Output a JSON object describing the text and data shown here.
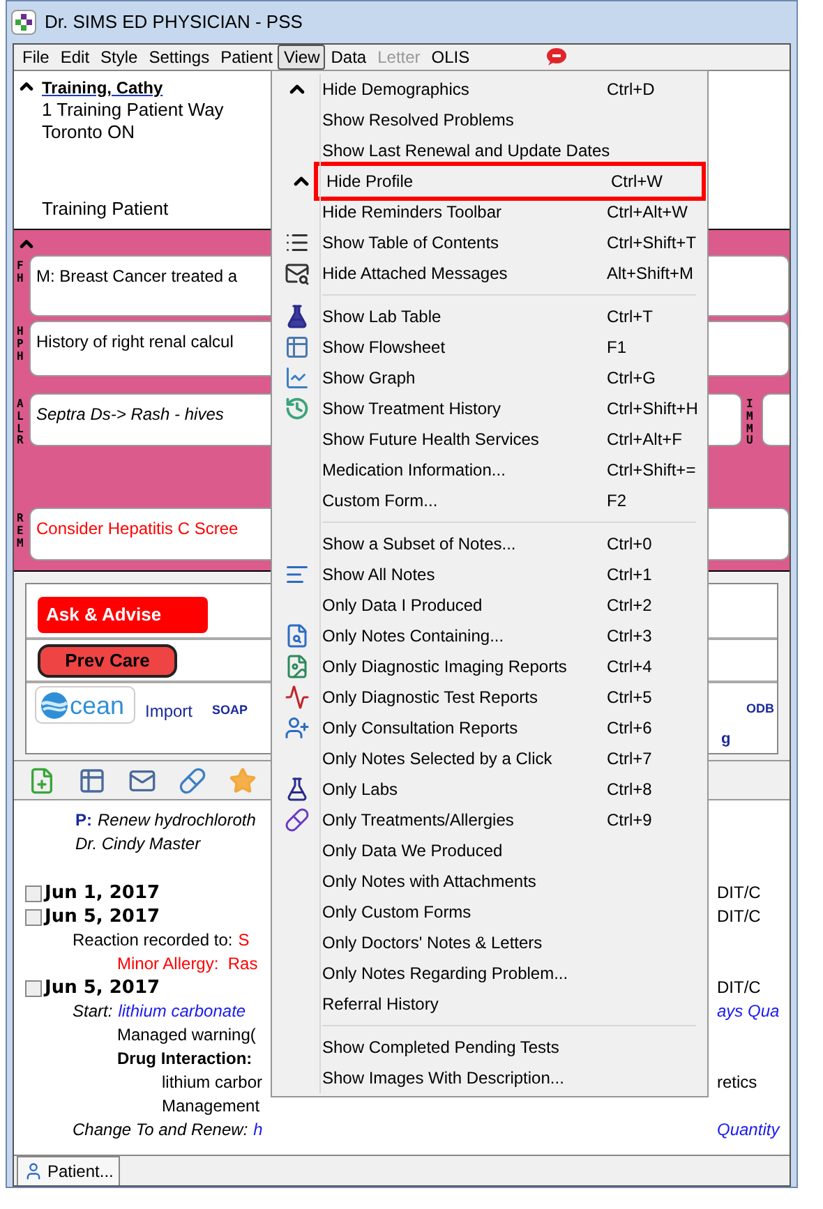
{
  "window": {
    "title": "Dr. SIMS ED PHYSICIAN - PSS"
  },
  "menu_bar": [
    {
      "label": "File",
      "selected": false,
      "disabled": false
    },
    {
      "label": "Edit",
      "selected": false,
      "disabled": false
    },
    {
      "label": "Style",
      "selected": false,
      "disabled": false
    },
    {
      "label": "Settings",
      "selected": false,
      "disabled": false
    },
    {
      "label": "Patient",
      "selected": false,
      "disabled": false
    },
    {
      "label": "View",
      "selected": true,
      "disabled": false
    },
    {
      "label": "Data",
      "selected": false,
      "disabled": false
    },
    {
      "label": "Letter",
      "selected": false,
      "disabled": true
    },
    {
      "label": "OLIS",
      "selected": false,
      "disabled": false
    }
  ],
  "demographics": {
    "name": "Training, Cathy",
    "address": [
      "1 Training Patient Way",
      "Toronto ON"
    ],
    "note": "Training Patient"
  },
  "profile": {
    "sections": [
      {
        "tag": "FH",
        "text": "M: Breast Cancer treated a"
      },
      {
        "tag": "HPH",
        "text": "History of right renal calcul"
      },
      {
        "tag": "ALLR",
        "text": "Septra Ds-> Rash - hives",
        "side_tag": "IMMU"
      },
      {
        "tag": "REM",
        "text": "Consider Hepatitis C Scree"
      }
    ]
  },
  "reminders": {
    "buttons": [
      {
        "label": "Ask & Advise",
        "kind": "flat"
      },
      {
        "label": "Prev Care",
        "kind": "outlined"
      }
    ],
    "logo_text": "cean",
    "links": [
      "Import",
      "SOAP"
    ],
    "right_links": [
      "ODB",
      "g"
    ]
  },
  "notes": {
    "lines": [
      {
        "kind": "plan",
        "label": "P:",
        "text": "Renew hydrochloroth"
      },
      {
        "kind": "signature",
        "text": "Dr. Cindy Master"
      },
      {
        "kind": "blank"
      },
      {
        "kind": "entry",
        "date": "Jun 1, 2017",
        "checked": false,
        "aside": "DIT/C"
      },
      {
        "kind": "entry",
        "date": "Jun 5, 2017",
        "checked": false,
        "aside": "DIT/C"
      },
      {
        "kind": "reaction",
        "label": "Reaction recorded to:",
        "value": "S"
      },
      {
        "kind": "allergy",
        "text": "Minor Allergy:  Ras"
      },
      {
        "kind": "entry",
        "date": "Jun 5, 2017",
        "checked": false,
        "aside": "DIT/C"
      },
      {
        "kind": "start",
        "label": "Start:",
        "value": "lithium carbonate",
        "aside": "ays Qua"
      },
      {
        "kind": "detail",
        "text": "Managed warning("
      },
      {
        "kind": "interaction",
        "text": "Drug Interaction:"
      },
      {
        "kind": "subdetail",
        "text": "lithium carbor",
        "aside": "retics"
      },
      {
        "kind": "subdetail",
        "text": "Management"
      },
      {
        "kind": "start",
        "label": "Change To and Renew:",
        "value": "h",
        "aside": "Quantity"
      }
    ]
  },
  "status_tabs": [
    {
      "label": "Patient..."
    }
  ],
  "view_menu": {
    "groups": [
      [
        {
          "label": "Hide Demographics",
          "shortcut": "Ctrl+D",
          "highlighted": false
        },
        {
          "label": "Show Resolved Problems",
          "highlighted": false
        },
        {
          "label": "Show Last Renewal and Update Dates",
          "highlighted": false
        },
        {
          "label": "Hide Profile",
          "shortcut": "Ctrl+W",
          "highlighted": true
        },
        {
          "label": "Hide Reminders Toolbar",
          "shortcut": "Ctrl+Alt+W",
          "highlighted": false
        },
        {
          "label": "Show Table of Contents",
          "shortcut": "Ctrl+Shift+T",
          "highlighted": false
        },
        {
          "label": "Hide Attached Messages",
          "shortcut": "Alt+Shift+M",
          "highlighted": false
        }
      ],
      [
        {
          "label": "Show Lab Table",
          "shortcut": "Ctrl+T",
          "highlighted": false
        },
        {
          "label": "Show Flowsheet",
          "shortcut": "F1",
          "highlighted": false
        },
        {
          "label": "Show Graph",
          "shortcut": "Ctrl+G",
          "highlighted": false
        },
        {
          "label": "Show Treatment History",
          "shortcut": "Ctrl+Shift+H",
          "highlighted": false
        },
        {
          "label": "Show Future Health Services",
          "shortcut": "Ctrl+Alt+F",
          "highlighted": false
        },
        {
          "label": "Medication Information...",
          "shortcut": "Ctrl+Shift+=",
          "highlighted": false
        },
        {
          "label": "Custom Form...",
          "shortcut": "F2",
          "highlighted": false
        }
      ],
      [
        {
          "label": "Show a Subset of Notes...",
          "shortcut": "Ctrl+0",
          "highlighted": false
        },
        {
          "label": "Show All Notes",
          "shortcut": "Ctrl+1",
          "highlighted": false
        },
        {
          "label": "Only Data I Produced",
          "shortcut": "Ctrl+2",
          "highlighted": false
        },
        {
          "label": "Only Notes Containing...",
          "shortcut": "Ctrl+3",
          "highlighted": false
        },
        {
          "label": "Only Diagnostic Imaging Reports",
          "shortcut": "Ctrl+4",
          "highlighted": false
        },
        {
          "label": "Only Diagnostic Test Reports",
          "shortcut": "Ctrl+5",
          "highlighted": false
        },
        {
          "label": "Only Consultation Reports",
          "shortcut": "Ctrl+6",
          "highlighted": false
        },
        {
          "label": "Only Notes Selected by a Click",
          "shortcut": "Ctrl+7",
          "highlighted": false
        },
        {
          "label": "Only Labs",
          "shortcut": "Ctrl+8",
          "highlighted": false
        },
        {
          "label": "Only Treatments/Allergies",
          "shortcut": "Ctrl+9",
          "highlighted": false
        },
        {
          "label": "Only Data We Produced",
          "highlighted": false
        },
        {
          "label": "Only Notes with Attachments",
          "highlighted": false
        },
        {
          "label": "Only Custom Forms",
          "highlighted": false
        },
        {
          "label": "Only Doctors' Notes & Letters",
          "highlighted": false
        },
        {
          "label": "Only Notes Regarding Problem...",
          "highlighted": false
        },
        {
          "label": "Referral History",
          "highlighted": false
        }
      ],
      [
        {
          "label": "Show Completed Pending Tests",
          "highlighted": false
        },
        {
          "label": "Show Images With Description...",
          "highlighted": false
        }
      ]
    ]
  }
}
